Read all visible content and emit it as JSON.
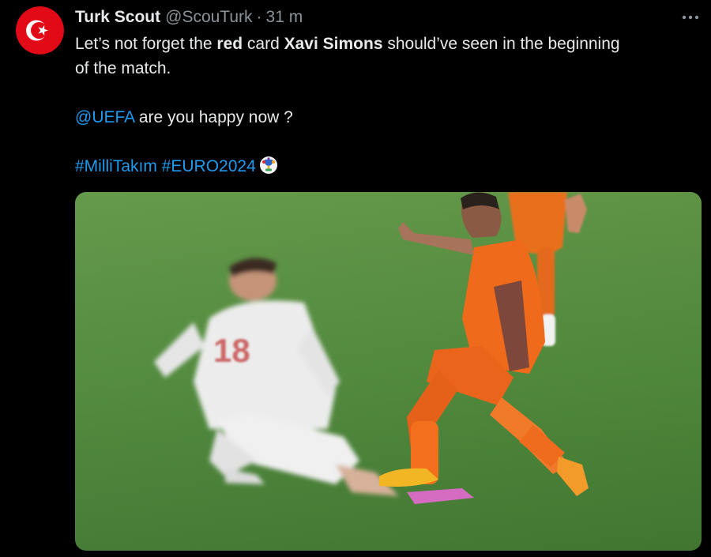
{
  "tweet": {
    "display_name": "Turk Scout",
    "handle": "@ScouTurk",
    "separator": "·",
    "time": "31 m",
    "avatar_icon": "turkey-flag-icon",
    "more_icon": "more-options-icon",
    "text": {
      "l1_a": "Let’s not forget the ",
      "l1_b": "red",
      "l1_c": " card ",
      "l1_d": "Xavi Simons",
      "l1_e": " should’ve seen in the beginning",
      "l2": "of the match.",
      "mention": "@UEFA",
      "mention_rest": " are you happy now ?",
      "hashtag1": "#MilliTakım",
      "hashtag2": "#EURO2024"
    },
    "hashtag_emoji": "euro2024-trophy-icon",
    "media": {
      "type": "photo",
      "description_icon": "match-photo",
      "jersey_number": "18"
    }
  },
  "colors": {
    "background": "#000000",
    "text": "#e7e9ea",
    "secondary": "#8b9298",
    "link": "#1d9bf0",
    "flag_red": "#e30a17",
    "pitch": "#4f8a3a",
    "orange_kit": "#f06a1c"
  }
}
